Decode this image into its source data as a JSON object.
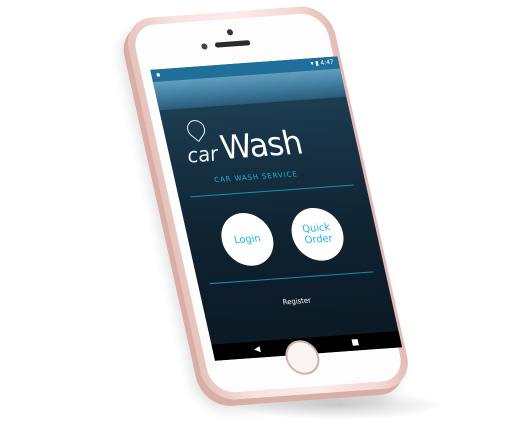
{
  "status_bar": {
    "left": "▪",
    "right": "▾ ▮ 4:47"
  },
  "brand": {
    "car": "car",
    "wash": "Wash",
    "tagline": "CAR WASH SERVICE"
  },
  "actions": {
    "login": "Login",
    "quick_order": "Quick Order",
    "register": "Register"
  },
  "nav": {
    "back": "◀",
    "home": "●",
    "recents": "■"
  },
  "colors": {
    "accent": "#1fb6dc",
    "phone_body": "#f7e3df",
    "status_bar": "#1f6f9a"
  }
}
